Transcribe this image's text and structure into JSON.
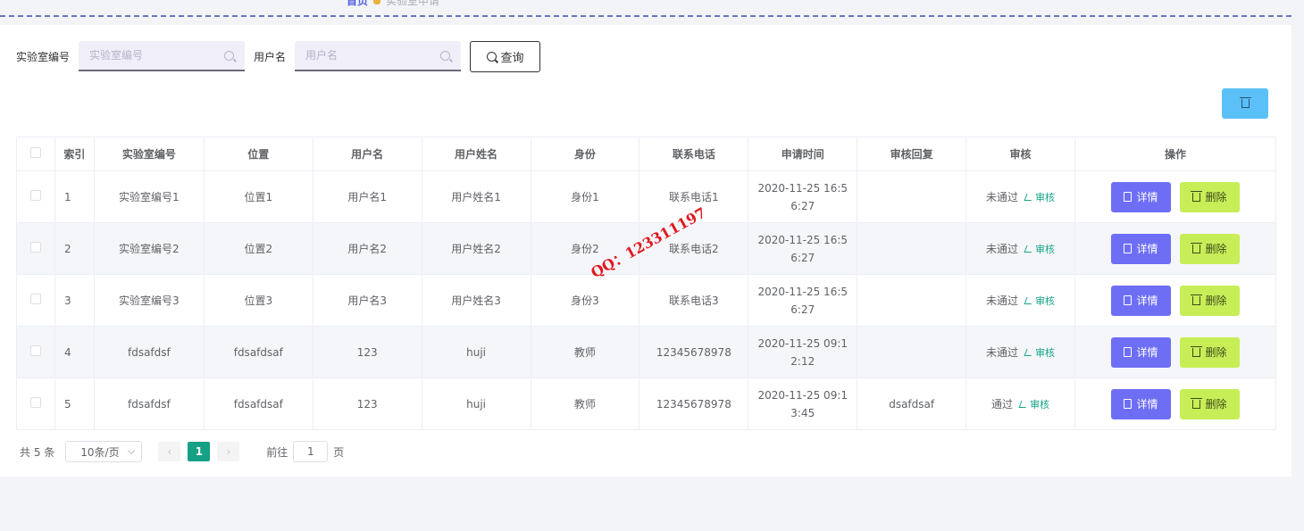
{
  "breadcrumb": {
    "home": "首页",
    "current": "实验室申请"
  },
  "search": {
    "lab_label": "实验室编号",
    "lab_placeholder": "实验室编号",
    "user_label": "用户名",
    "user_placeholder": "用户名",
    "query_label": "查询"
  },
  "table": {
    "headers": [
      "索引",
      "实验室编号",
      "位置",
      "用户名",
      "用户姓名",
      "身份",
      "联系电话",
      "申请时间",
      "审核回复",
      "审核",
      "操作"
    ],
    "rows": [
      {
        "index": "1",
        "lab": "实验室编号1",
        "location": "位置1",
        "username": "用户名1",
        "name": "用户姓名1",
        "role": "身份1",
        "phone": "联系电话1",
        "time1": "2020-11-25 16:5",
        "time2": "6:27",
        "reply": "",
        "status": "未通过"
      },
      {
        "index": "2",
        "lab": "实验室编号2",
        "location": "位置2",
        "username": "用户名2",
        "name": "用户姓名2",
        "role": "身份2",
        "phone": "联系电话2",
        "time1": "2020-11-25 16:5",
        "time2": "6:27",
        "reply": "",
        "status": "未通过"
      },
      {
        "index": "3",
        "lab": "实验室编号3",
        "location": "位置3",
        "username": "用户名3",
        "name": "用户姓名3",
        "role": "身份3",
        "phone": "联系电话3",
        "time1": "2020-11-25 16:5",
        "time2": "6:27",
        "reply": "",
        "status": "未通过"
      },
      {
        "index": "4",
        "lab": "fdsafdsf",
        "location": "fdsafdsaf",
        "username": "123",
        "name": "huji",
        "role": "教师",
        "phone": "12345678978",
        "time1": "2020-11-25 09:1",
        "time2": "2:12",
        "reply": "",
        "status": "未通过"
      },
      {
        "index": "5",
        "lab": "fdsafdsf",
        "location": "fdsafdsaf",
        "username": "123",
        "name": "huji",
        "role": "教师",
        "phone": "12345678978",
        "time1": "2020-11-25 09:1",
        "time2": "3:45",
        "reply": "dsafdsaf",
        "status": "通过"
      }
    ],
    "audit_label": "审核",
    "detail_label": "详情",
    "delete_label": "删除"
  },
  "pagination": {
    "total": "共 5 条",
    "page_size": "10条/页",
    "prev": "‹",
    "current_page": "1",
    "next": "›",
    "goto_prefix": "前往",
    "goto_value": "1",
    "goto_suffix": "页"
  },
  "watermark": "QQ：123311197",
  "colors": {
    "accent_green": "#16a085",
    "detail_button": "#6e6ef5",
    "delete_button": "#c7ee57",
    "batch_delete": "#5bc0f8"
  }
}
